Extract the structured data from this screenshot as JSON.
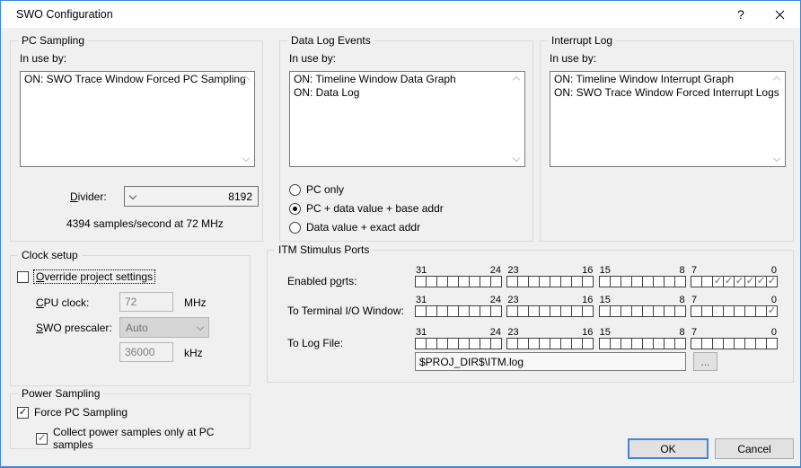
{
  "window": {
    "title": "SWO Configuration",
    "help_glyph": "?"
  },
  "colors": {
    "accent": "#3f87dd",
    "dialog_bg": "#f0f0f0",
    "titlebar_bg": "#ffffff"
  },
  "pc_sampling": {
    "title": "PC Sampling",
    "in_use_label": "In use by:",
    "items": [
      "ON: SWO Trace Window Forced PC Sampling"
    ],
    "divider_label": {
      "pre": "",
      "key": "D",
      "post": "ivider:"
    },
    "divider_value": "8192",
    "samples_text": "4394 samples/second at 72 MHz"
  },
  "data_log": {
    "title": "Data Log Events",
    "in_use_label": "In use by:",
    "items": [
      "ON: Timeline Window Data Graph",
      "ON: Data Log"
    ],
    "radios": [
      {
        "name": "pc-only",
        "label": "PC only",
        "selected": false
      },
      {
        "name": "pc-data-value-base-addr",
        "label": "PC + data value + base addr",
        "selected": true
      },
      {
        "name": "data-value-exact-addr",
        "label": "Data value + exact addr",
        "selected": false
      }
    ]
  },
  "interrupt_log": {
    "title": "Interrupt Log",
    "in_use_label": "In use by:",
    "items": [
      "ON: Timeline Window Interrupt Graph",
      "ON: SWO Trace Window Forced Interrupt Logs"
    ]
  },
  "clock_setup": {
    "title": "Clock setup",
    "override_label": {
      "pre": "",
      "key": "O",
      "post": "verride project settings"
    },
    "override_checked": false,
    "cpu_clock_label": {
      "pre": "",
      "key": "C",
      "post": "PU clock:"
    },
    "cpu_clock_value": "72",
    "cpu_clock_unit": "MHz",
    "prescaler_label": {
      "pre": "",
      "key": "S",
      "post": "WO prescaler:"
    },
    "prescaler_value": "Auto",
    "prescaler_freq": "36000",
    "prescaler_freq_unit": "kHz"
  },
  "itm": {
    "title": "ITM Stimulus Ports",
    "bit_labels": [
      [
        "31",
        "24"
      ],
      [
        "23",
        "16"
      ],
      [
        "15",
        "8"
      ],
      [
        "7",
        "0"
      ]
    ],
    "rows": [
      {
        "name": "enabled-ports",
        "label": {
          "pre": "Enabled p",
          "key": "o",
          "post": "rts:"
        },
        "checked_bits": [
          5,
          4,
          3,
          2,
          1,
          0
        ]
      },
      {
        "name": "terminal-io-window",
        "label": "To Terminal I/O Window:",
        "checked_bits": [
          0
        ]
      },
      {
        "name": "log-file",
        "label": "To Log File:",
        "checked_bits": []
      }
    ],
    "log_file_path": "$PROJ_DIR$\\ITM.log",
    "browse_label": "..."
  },
  "power": {
    "title": "Power Sampling",
    "force_label": "Force PC Sampling",
    "force_checked": true,
    "collect_label": "Collect power samples only at PC samples",
    "collect_checked": true
  },
  "buttons": {
    "ok": "OK",
    "cancel": "Cancel"
  }
}
